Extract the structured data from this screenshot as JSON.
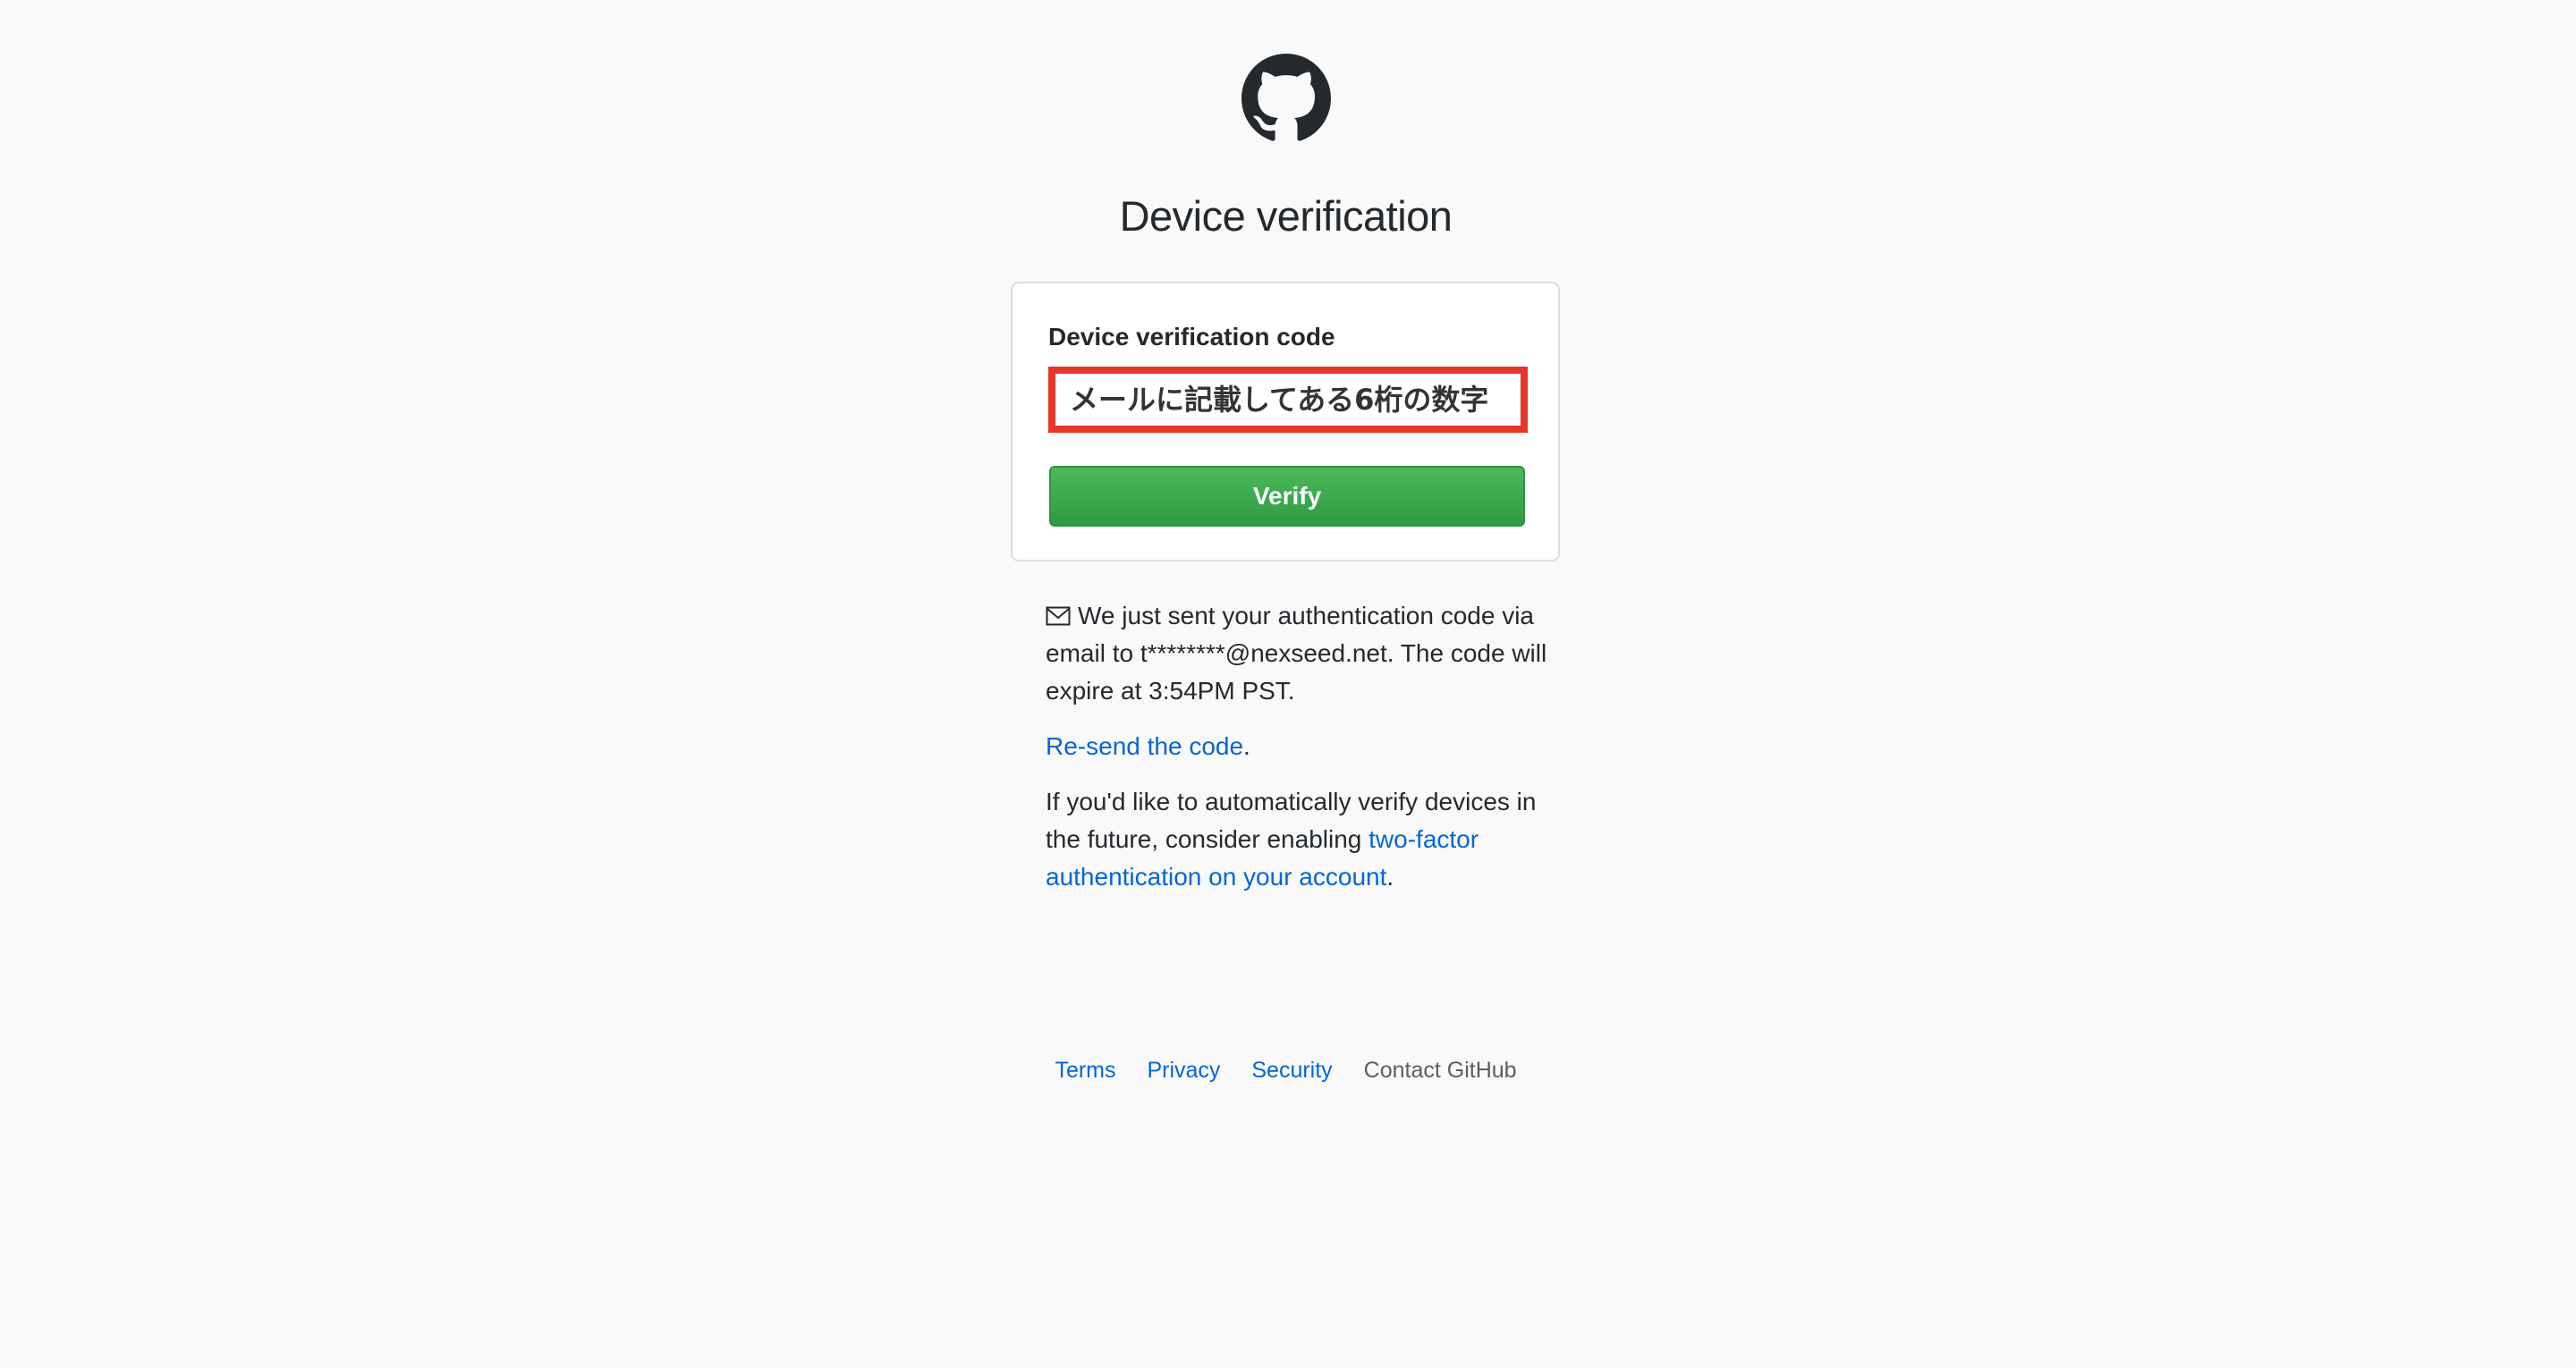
{
  "header": {
    "logo_icon": "github-octocat-icon",
    "title": "Device verification"
  },
  "form": {
    "label": "Device verification code",
    "code_value": "メールに記載してある6桁の数字",
    "highlight_color": "#e6372a",
    "verify_label": "Verify",
    "button_color": "#3aa74d"
  },
  "info": {
    "mail_icon": "mail-icon",
    "sent_message": "We just sent your authentication code via email to t********@nexseed.net. The code will expire at 3:54PM PST.",
    "resend_link": "Re-send the code",
    "resend_suffix": ".",
    "auto_prefix": "If you'd like to automatically verify devices in the future, consider enabling ",
    "two_factor_link": "two-factor authentication on your account",
    "auto_suffix": "."
  },
  "footer": {
    "links": [
      "Terms",
      "Privacy",
      "Security"
    ],
    "contact": "Contact GitHub"
  },
  "colors": {
    "link": "#0366d6",
    "background": "#f9f9f9"
  }
}
